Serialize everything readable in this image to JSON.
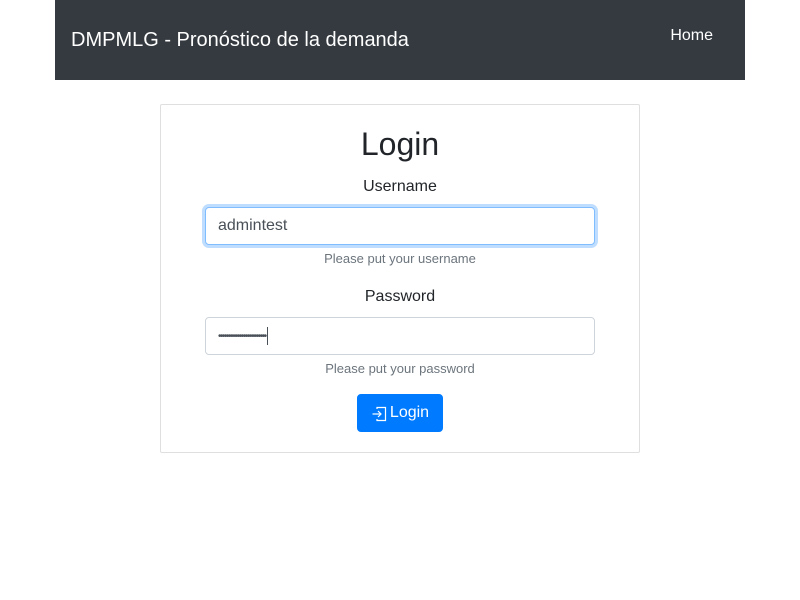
{
  "navbar": {
    "brand": "DMPMLG - Pronóstico de la demanda",
    "home_link": "Home"
  },
  "login_card": {
    "title": "Login",
    "username": {
      "label": "Username",
      "value": "admintest",
      "help": "Please put your username"
    },
    "password": {
      "label": "Password",
      "value": "•••••••••••••••••••••••••",
      "help": "Please put your password"
    },
    "submit": {
      "label": "Login",
      "icon": "sign-in-icon"
    }
  },
  "colors": {
    "navbar_bg": "#343a40",
    "primary": "#007bff",
    "focus_border": "#80bdff",
    "help_text": "#6c757d"
  }
}
